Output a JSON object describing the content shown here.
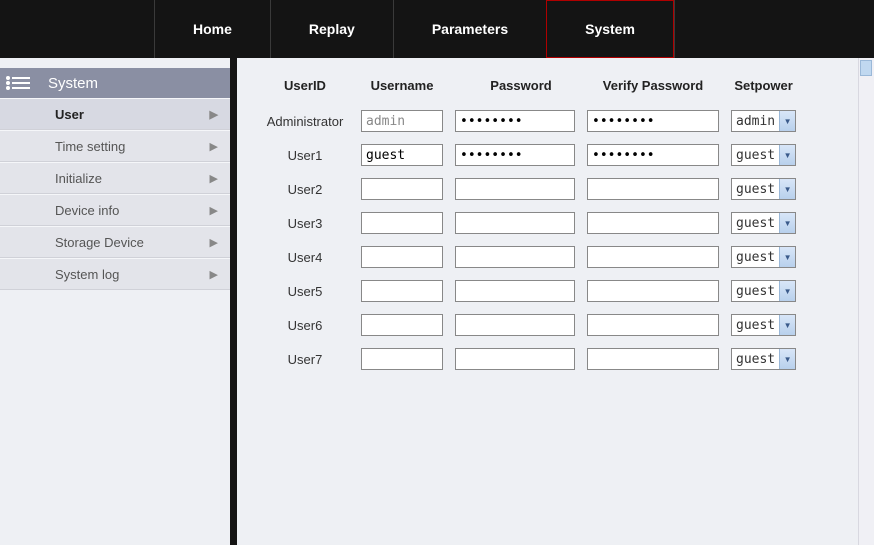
{
  "topnav": {
    "items": [
      {
        "label": "Home"
      },
      {
        "label": "Replay"
      },
      {
        "label": "Parameters"
      },
      {
        "label": "System"
      }
    ]
  },
  "sidebar": {
    "title": "System",
    "items": [
      {
        "label": "User"
      },
      {
        "label": "Time setting"
      },
      {
        "label": "Initialize"
      },
      {
        "label": "Device info"
      },
      {
        "label": "Storage Device"
      },
      {
        "label": "System log"
      }
    ]
  },
  "table": {
    "headers": {
      "userid": "UserID",
      "username": "Username",
      "password": "Password",
      "verify": "Verify Password",
      "setpower": "Setpower"
    },
    "rows": [
      {
        "userid": "Administrator",
        "username": "admin",
        "username_disabled": true,
        "password": "••••••••",
        "verify": "••••••••",
        "setpower": "admin"
      },
      {
        "userid": "User1",
        "username": "guest",
        "username_disabled": false,
        "password": "••••••••",
        "verify": "••••••••",
        "setpower": "guest"
      },
      {
        "userid": "User2",
        "username": "",
        "username_disabled": false,
        "password": "",
        "verify": "",
        "setpower": "guest"
      },
      {
        "userid": "User3",
        "username": "",
        "username_disabled": false,
        "password": "",
        "verify": "",
        "setpower": "guest"
      },
      {
        "userid": "User4",
        "username": "",
        "username_disabled": false,
        "password": "",
        "verify": "",
        "setpower": "guest"
      },
      {
        "userid": "User5",
        "username": "",
        "username_disabled": false,
        "password": "",
        "verify": "",
        "setpower": "guest"
      },
      {
        "userid": "User6",
        "username": "",
        "username_disabled": false,
        "password": "",
        "verify": "",
        "setpower": "guest"
      },
      {
        "userid": "User7",
        "username": "",
        "username_disabled": false,
        "password": "",
        "verify": "",
        "setpower": "guest"
      }
    ]
  }
}
